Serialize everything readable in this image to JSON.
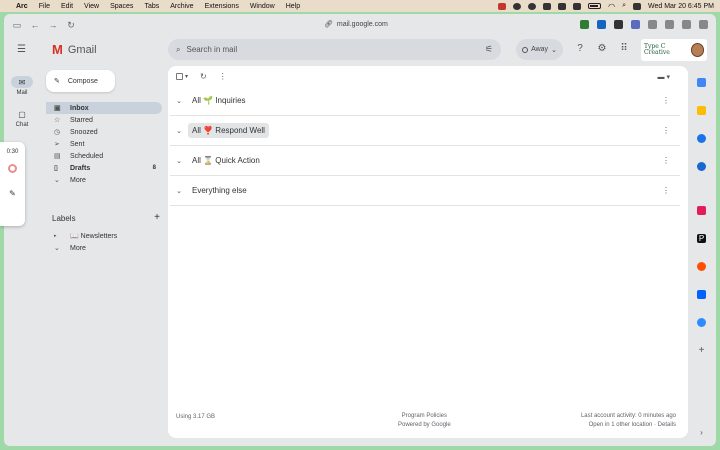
{
  "menubar": {
    "app": "Arc",
    "menus": [
      "File",
      "Edit",
      "View",
      "Spaces",
      "Tabs",
      "Archive",
      "Extensions",
      "Window",
      "Help"
    ],
    "clock": "Wed Mar 20  6:45 PM"
  },
  "browser": {
    "url": "mail.google.com"
  },
  "gmail": {
    "product": "Gmail",
    "search_placeholder": "Search in mail",
    "status_label": "Away",
    "brand_badge": "Type C Creative"
  },
  "rail": {
    "mail_label": "Mail",
    "chat_label": "Chat"
  },
  "widget": {
    "time": "0:30"
  },
  "compose_label": "Compose",
  "nav": [
    {
      "label": "Inbox",
      "icon": "inbox-icon",
      "count": "",
      "active": true
    },
    {
      "label": "Starred",
      "icon": "star-icon",
      "count": ""
    },
    {
      "label": "Snoozed",
      "icon": "clock-icon",
      "count": ""
    },
    {
      "label": "Sent",
      "icon": "send-icon",
      "count": ""
    },
    {
      "label": "Scheduled",
      "icon": "schedule-icon",
      "count": ""
    },
    {
      "label": "Drafts",
      "icon": "draft-icon",
      "count": "8"
    },
    {
      "label": "More",
      "icon": "chevron-down-icon",
      "count": ""
    }
  ],
  "labels": {
    "heading": "Labels",
    "items": [
      {
        "label": "📖 Newsletters"
      },
      {
        "label": "More"
      }
    ]
  },
  "sections": [
    {
      "title": "All 🌱 Inquiries"
    },
    {
      "title": "All ❣️ Respond Well"
    },
    {
      "title": "All ⌛ Quick Action"
    },
    {
      "title": "Everything else"
    }
  ],
  "footer": {
    "storage": "Using 3.17 GB",
    "policies": "Program Policies",
    "powered": "Powered by Google",
    "activity": "Last account activity: 0 minutes ago",
    "location": "Open in 1 other location · Details"
  },
  "colors": {
    "desktop": "#9fd9a8",
    "active_nav": "#c9d2dc",
    "gmail_red": "#d93025"
  }
}
